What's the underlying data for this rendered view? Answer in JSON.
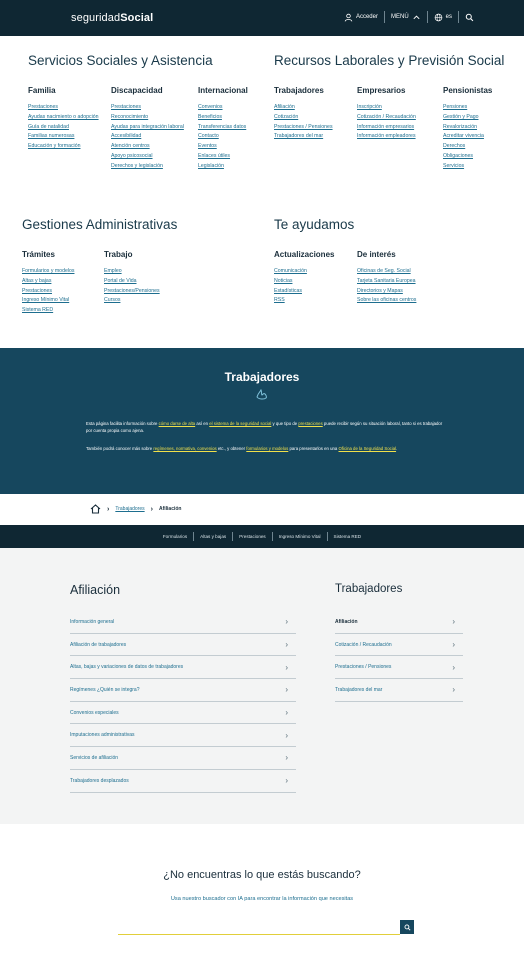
{
  "header": {
    "brand_light": "seguridad",
    "brand_bold": "Social",
    "access": "Acceder",
    "menu": "MENÚ",
    "language": "es"
  },
  "menu": {
    "servicios": {
      "title": "Servicios Sociales y Asistencia",
      "columns": [
        {
          "head": "Familia",
          "items": [
            "Prestaciones",
            "Ayudas nacimiento o adopción",
            "Guía de natalidad",
            "Familias numerosas",
            "Educación y formación"
          ]
        },
        {
          "head": "Discapacidad",
          "items": [
            "Prestaciones",
            "Reconocimiento",
            "Ayudas para integración laboral",
            "Accesibilidad",
            "Atención centros",
            "Apoyo psicosocial",
            "Derechos y legislación"
          ]
        },
        {
          "head": "Internacional",
          "items": [
            "Convenios",
            "Beneficios",
            "Transferencias datos",
            "Contacto",
            "Eventos",
            "Enlaces útiles",
            "Legislación"
          ]
        }
      ]
    },
    "recursos": {
      "title": "Recursos Laborales y Previsión Social",
      "columns": [
        {
          "head": "Trabajadores",
          "items": [
            "Afiliación",
            "Cotización",
            "Prestaciones / Pensiones",
            "Trabajadores del mar"
          ]
        },
        {
          "head": "Empresarios",
          "items": [
            "Inscripción",
            "Cotización / Recaudación",
            "Información empresarios",
            "Información empleadores"
          ]
        },
        {
          "head": "Pensionistas",
          "items": [
            "Pensiones",
            "Gestión y Pago",
            "Revalorización",
            "Acreditar vivencia",
            "Derechos",
            "Obligaciones",
            "Servicios"
          ]
        }
      ]
    },
    "gestiones": {
      "title": "Gestiones Administrativas",
      "columns": [
        {
          "head": "Trámites",
          "items": [
            "Formularios y modelos",
            "Altas y bajas",
            "Prestaciones",
            "Ingreso Mínimo Vital",
            "Sistema RED"
          ]
        },
        {
          "head": "Trabajo",
          "items": [
            "Empleo",
            "Portal de Vida",
            "Prestaciones/Pensiones",
            "Cursos"
          ]
        }
      ]
    },
    "ayudamos": {
      "title": "Te ayudamos",
      "columns": [
        {
          "head": "Actualizaciones",
          "items": [
            "Comunicación",
            "Noticias",
            "Estadísticas",
            "RSS"
          ]
        },
        {
          "head": "De interés",
          "items": [
            "Oficinas de Seg. Social",
            "Tarjeta Sanitaria Europea",
            "Directorios y Mapas",
            "Sobre las oficinas centros"
          ]
        }
      ]
    }
  },
  "hero": {
    "title": "Trabajadores",
    "p1_a": "Esta página facilita información sobre ",
    "p1_l1": "cómo darse de alta",
    "p1_b": " así en ",
    "p1_l2": "el sistema de la seguridad social",
    "p1_c": " y que tipo de ",
    "p1_l3": "prestaciones",
    "p1_d": " puede recibir según su situación laboral, tanto si es trabajador por cuenta propia como ajena.",
    "p2_a": "También podrá conocer más sobre ",
    "p2_l1": "regímenes, normativa, convenios",
    "p2_b": " etc., y obtener ",
    "p2_l2": "formularios y modelos",
    "p2_c": " para presentarlos en una ",
    "p2_l3": "Oficina de la Seguridad Social",
    "p2_d": "."
  },
  "breadcrumb": {
    "level1": "Trabajadores",
    "current": "Afiliación"
  },
  "subnav": [
    "Formularios",
    "Altas y bajas",
    "Prestaciones",
    "Ingreso Mínimo Vital",
    "Sistema RED"
  ],
  "afiliacion": {
    "title": "Afiliación",
    "items": [
      "Información general",
      "Afiliación de trabajadores",
      "Altas, bajas y variaciones de datos de trabajadores",
      "Regímenes ¿Quién se integra?",
      "Convenios especiales",
      "Imputaciones administrativas",
      "Servicios de afiliación",
      "Trabajadores desplazados"
    ]
  },
  "trabajadores": {
    "title": "Trabajadores",
    "items": [
      "Afiliación",
      "Cotización / Recaudación",
      "Prestaciones / Pensiones",
      "Trabajadores del mar"
    ]
  },
  "footer": {
    "question": "¿No encuentras lo que estás buscando?",
    "sub": "Usa nuestro buscador con IA para encontrar la información que necesitas",
    "placeholder": ""
  }
}
